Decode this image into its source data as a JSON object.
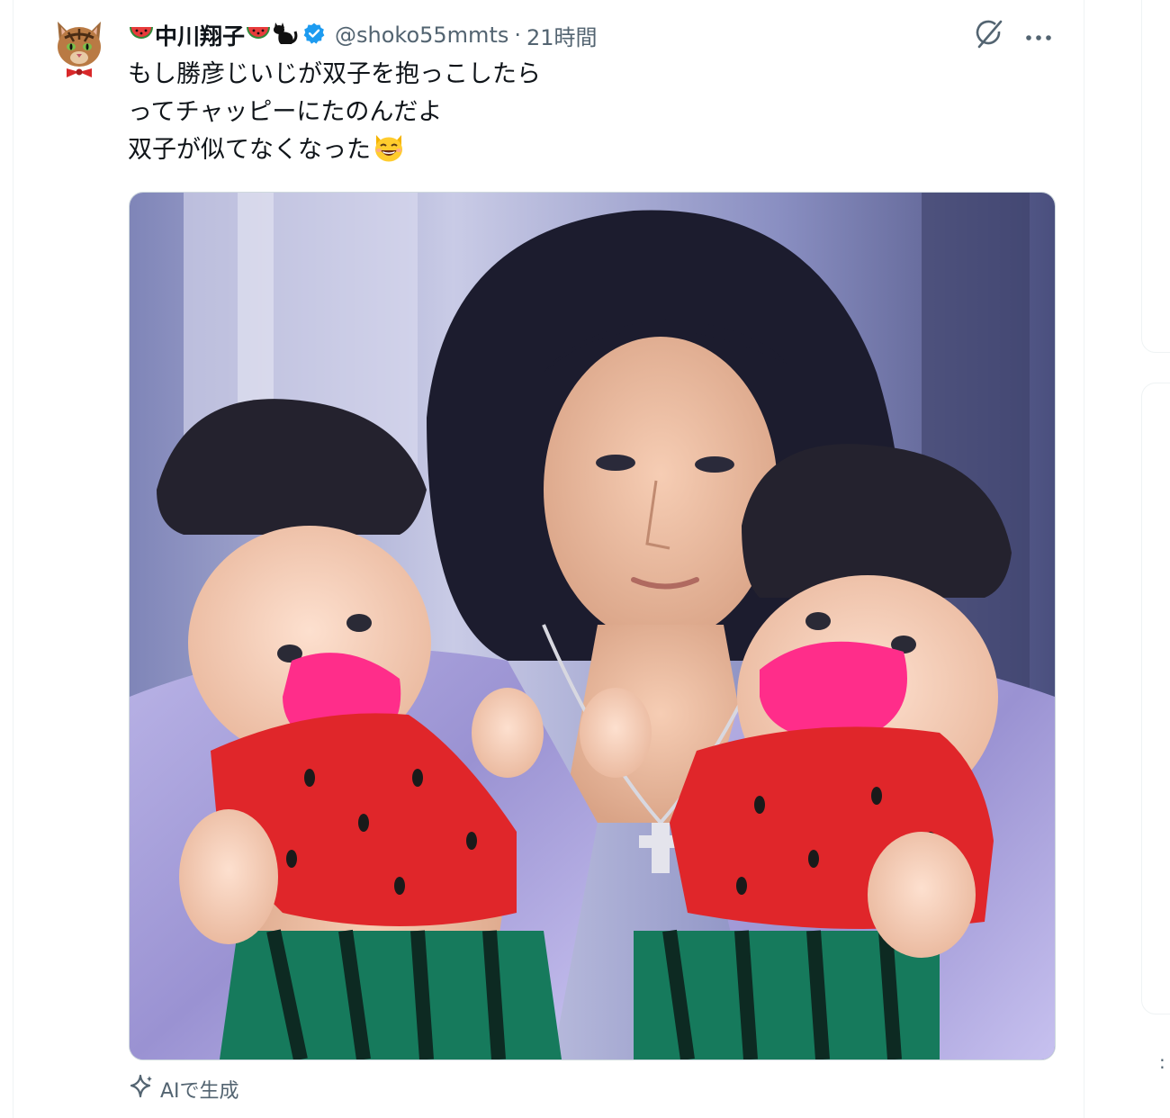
{
  "tweet": {
    "display_name": "中川翔子",
    "handle": "@shoko55mmts",
    "separator": "·",
    "time": "21時間",
    "lines": [
      "もし勝彦じいじが双子を抱っこしたら",
      "ってチャッピーにたのんだよ",
      "双子が似てなくなった"
    ],
    "ai_label": "AIで生成"
  },
  "icons": {
    "avatar": "cat-avatar-icon",
    "name_emoji": [
      "watermelon-icon",
      "watermelon-icon",
      "black-cat-icon"
    ],
    "verified": "verified-badge-icon",
    "grok": "grok-icon",
    "more": "more-icon",
    "line_end_emoji": "grinning-cat-icon",
    "sparkle": "sparkle-icon"
  },
  "colors": {
    "verified_blue": "#1d9bf0",
    "secondary_text": "#536471",
    "primary_text": "#0f1419",
    "border": "#cfd9de",
    "blur_pink": "#ff2d8a"
  }
}
